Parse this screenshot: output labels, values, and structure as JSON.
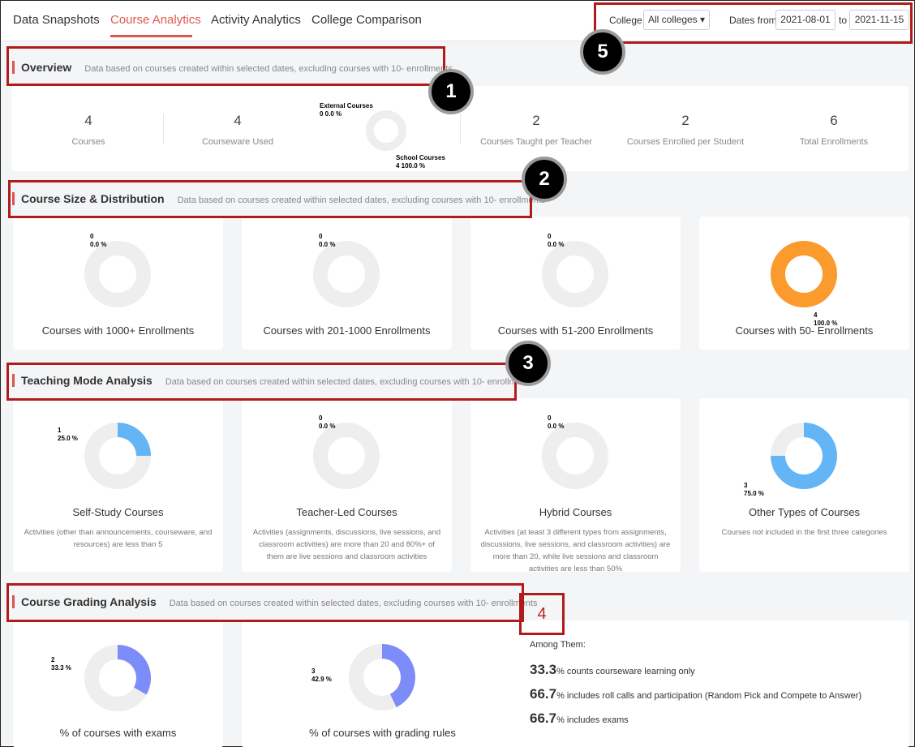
{
  "tabs": [
    {
      "label": "Data Snapshots"
    },
    {
      "label": "Course Analytics"
    },
    {
      "label": "Activity Analytics"
    },
    {
      "label": "College Comparison"
    }
  ],
  "filters": {
    "college_label": "College",
    "college_value": "All colleges ▾",
    "dates_label": "Dates from",
    "date_from": "2021-08-01",
    "to_label": "to",
    "date_to": "2021-11-15"
  },
  "callouts": [
    "1",
    "2",
    "3",
    "4",
    "5"
  ],
  "colors": {
    "accent": "#e0584a",
    "annotation": "#b01c1c",
    "teal": "#49dcb1",
    "orange": "#fb9a2d",
    "blue": "#64b5f6",
    "indigo": "#7c8cf8",
    "gray": "#eeeeee"
  },
  "subtitle": "Data based on courses created within selected dates, excluding courses with 10- enrollments",
  "overview": {
    "title": "Overview",
    "stats": [
      {
        "value": "4",
        "label": "Courses"
      },
      {
        "value": "4",
        "label": "Courseware Used"
      },
      {
        "value": "2",
        "label": "Courses Taught per Teacher"
      },
      {
        "value": "2",
        "label": "Courses Enrolled per Student"
      },
      {
        "value": "6",
        "label": "Total Enrollments"
      }
    ],
    "donut": {
      "external_label": "External Courses",
      "external_value": "0 0.0 %",
      "school_label": "School Courses",
      "school_value": "4 100.0 %"
    }
  },
  "size": {
    "title": "Course Size & Distribution",
    "charts": [
      {
        "title": "Courses with 1000+ Enrollments",
        "count": "0",
        "pct": "0.0 %"
      },
      {
        "title": "Courses with 201-1000 Enrollments",
        "count": "0",
        "pct": "0.0 %"
      },
      {
        "title": "Courses with 51-200 Enrollments",
        "count": "0",
        "pct": "0.0 %"
      },
      {
        "title": "Courses with 50- Enrollments",
        "count": "4",
        "pct": "100.0 %"
      }
    ]
  },
  "teaching": {
    "title": "Teaching Mode Analysis",
    "charts": [
      {
        "title": "Self-Study Courses",
        "count": "1",
        "pct": "25.0 %",
        "desc": "Activities (other than announcements, courseware, and resources) are less than 5"
      },
      {
        "title": "Teacher-Led Courses",
        "count": "0",
        "pct": "0.0 %",
        "desc": "Activities (assignments, discussions, live sessions, and classroom activities) are more than 20 and 80%+ of them are live sessions and classroom activities"
      },
      {
        "title": "Hybrid Courses",
        "count": "0",
        "pct": "0.0 %",
        "desc": "Activities (at least 3 different types from assignments, discussions, live sessions, and classroom activities) are more than 20, while live sessions and classroom activities are less than 50%"
      },
      {
        "title": "Other Types of Courses",
        "count": "3",
        "pct": "75.0 %",
        "desc": "Courses not included in the first three categories"
      }
    ]
  },
  "grading": {
    "title": "Course Grading Analysis",
    "charts": [
      {
        "title": "% of courses with exams",
        "count": "2",
        "pct": "33.3 %"
      },
      {
        "title": "% of courses with grading rules",
        "count": "3",
        "pct": "42.9 %"
      }
    ],
    "among_label": "Among Them:",
    "lines": [
      {
        "value": "33.3",
        "text": "% counts courseware learning only"
      },
      {
        "value": "66.7",
        "text": "% includes roll calls and participation (Random Pick and Compete to Answer)"
      },
      {
        "value": "66.7",
        "text": "% includes exams"
      }
    ]
  },
  "chart_data": [
    {
      "type": "pie",
      "categories": [
        "External Courses",
        "School Courses"
      ],
      "values": [
        0,
        4
      ]
    },
    {
      "type": "pie",
      "title": "Courses with 1000+ Enrollments",
      "values": [
        0,
        4
      ]
    },
    {
      "type": "pie",
      "title": "Courses with 201-1000 Enrollments",
      "values": [
        0,
        4
      ]
    },
    {
      "type": "pie",
      "title": "Courses with 51-200 Enrollments",
      "values": [
        0,
        4
      ]
    },
    {
      "type": "pie",
      "title": "Courses with 50- Enrollments",
      "values": [
        4,
        0
      ]
    },
    {
      "type": "pie",
      "title": "Self-Study Courses",
      "values": [
        1,
        3
      ]
    },
    {
      "type": "pie",
      "title": "Teacher-Led Courses",
      "values": [
        0,
        4
      ]
    },
    {
      "type": "pie",
      "title": "Hybrid Courses",
      "values": [
        0,
        4
      ]
    },
    {
      "type": "pie",
      "title": "Other Types of Courses",
      "values": [
        3,
        1
      ]
    },
    {
      "type": "pie",
      "title": "% of courses with exams",
      "values": [
        33.3,
        66.7
      ]
    },
    {
      "type": "pie",
      "title": "% of courses with grading rules",
      "values": [
        42.9,
        57.1
      ]
    }
  ]
}
